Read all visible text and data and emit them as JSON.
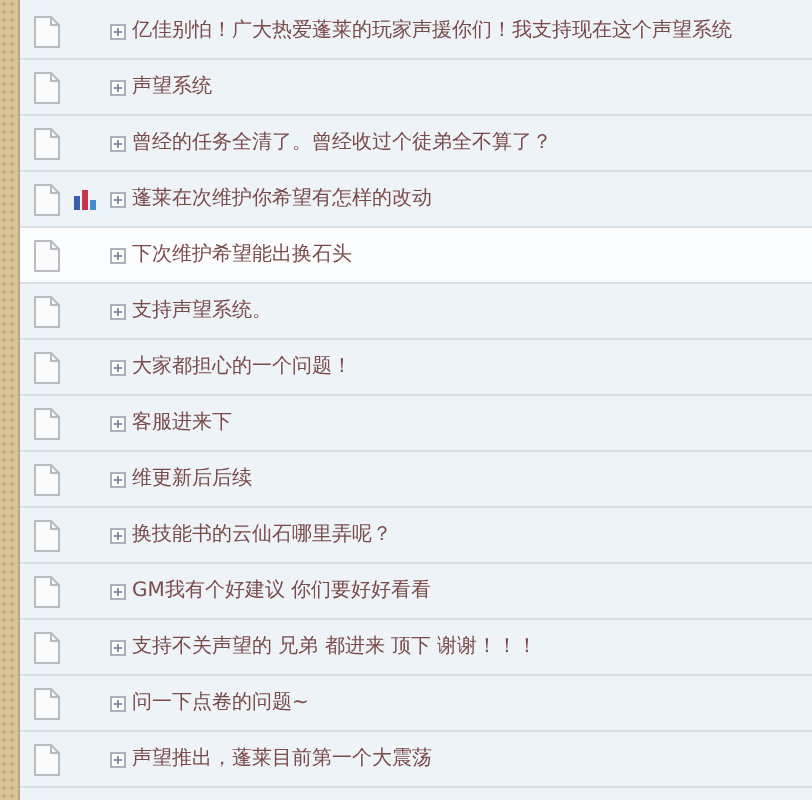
{
  "threads": [
    {
      "title": "亿佳别怕！广大热爱蓬莱的玩家声援你们！我支持现在这个声望系统",
      "kind": "normal",
      "highlighted": false
    },
    {
      "title": "声望系统",
      "kind": "normal",
      "highlighted": false
    },
    {
      "title": "曾经的任务全清了。曾经收过个徒弟全不算了？",
      "kind": "normal",
      "highlighted": false
    },
    {
      "title": "蓬莱在次维护你希望有怎样的改动",
      "kind": "poll",
      "highlighted": false
    },
    {
      "title": "下次维护希望能出换石头",
      "kind": "normal",
      "highlighted": true
    },
    {
      "title": "支持声望系统。",
      "kind": "normal",
      "highlighted": false
    },
    {
      "title": "大家都担心的一个问题！",
      "kind": "normal",
      "highlighted": false
    },
    {
      "title": "客服进来下",
      "kind": "normal",
      "highlighted": false
    },
    {
      "title": "维更新后后续",
      "kind": "normal",
      "highlighted": false
    },
    {
      "title": "换技能书的云仙石哪里弄呢？",
      "kind": "normal",
      "highlighted": false
    },
    {
      "title": "GM我有个好建议 你们要好好看看",
      "kind": "normal",
      "highlighted": false
    },
    {
      "title": "支持不关声望的 兄弟 都进来 顶下 谢谢！！！",
      "kind": "normal",
      "highlighted": false
    },
    {
      "title": "问一下点卷的问题~",
      "kind": "normal",
      "highlighted": false
    },
    {
      "title": "声望推出，蓬莱目前第一个大震荡",
      "kind": "normal",
      "highlighted": false
    }
  ]
}
